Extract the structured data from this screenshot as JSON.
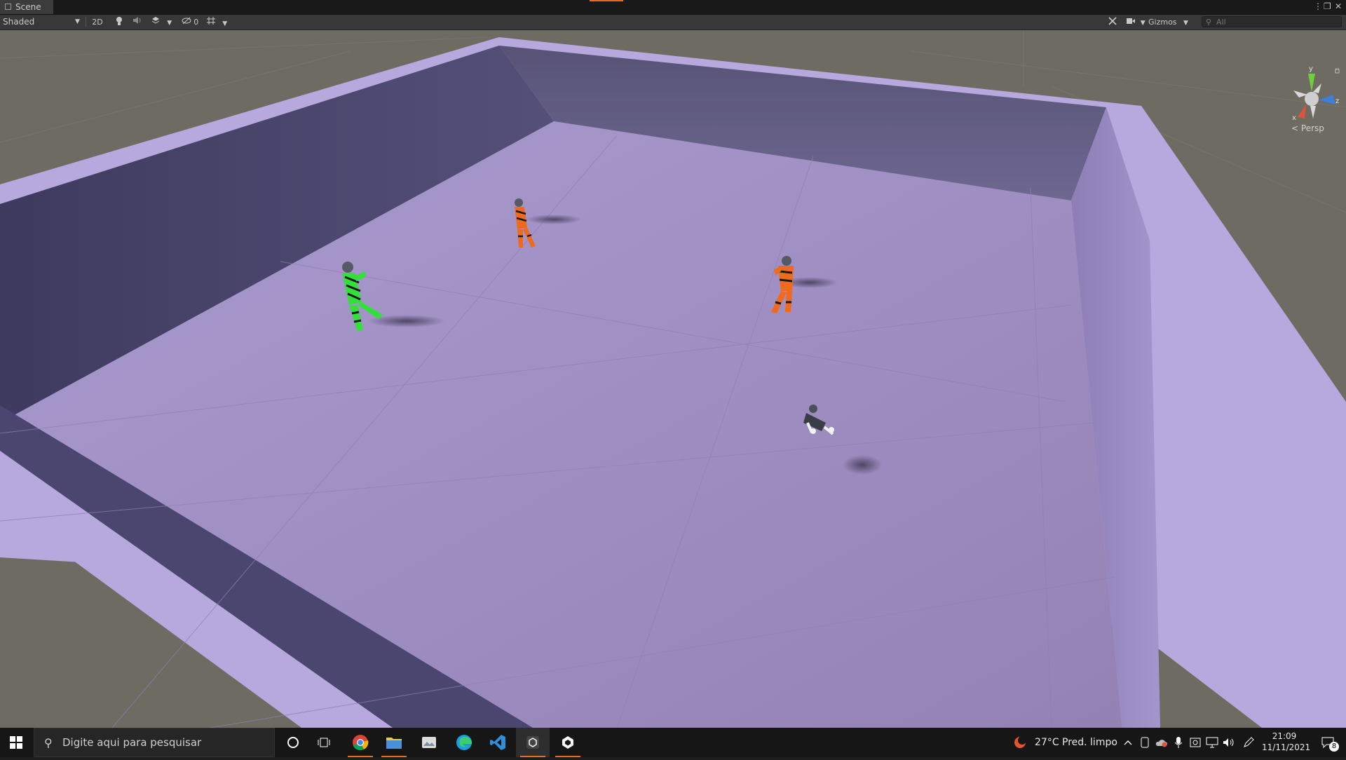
{
  "window": {
    "tab_label": "Scene",
    "controls": [
      "⋮",
      "❐",
      "✕"
    ]
  },
  "toolbar": {
    "draw_mode": "Shaded",
    "btn_2d": "2D",
    "hidden_count": "0",
    "gizmos_label": "Gizmos",
    "search_placeholder": "All"
  },
  "scene": {
    "view_label": "Persp",
    "axes": {
      "y": "y",
      "z": "z",
      "x": "x"
    },
    "colors": {
      "floor": "#a392c4",
      "wall_top": "#b9a9df",
      "wall_inner": "#4d4870",
      "ground": "#6e6b63",
      "agent_green": "#33e03b",
      "agent_orange": "#f06a1e"
    },
    "objects": [
      "agent-green",
      "agent-orange-1",
      "agent-orange-2",
      "agent-crouched"
    ]
  },
  "taskbar": {
    "search_placeholder": "Digite aqui para pesquisar",
    "weather_temp": "27°C",
    "weather_desc": "Pred. limpo",
    "time": "21:09",
    "date": "11/11/2021",
    "notifications": "8",
    "apps": [
      "cortana",
      "task-view",
      "chrome",
      "file-explorer",
      "app-viewer",
      "edge",
      "vscode",
      "unity-hub",
      "unity"
    ]
  }
}
